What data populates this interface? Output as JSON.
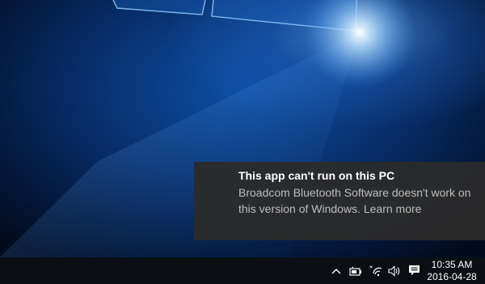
{
  "notification": {
    "title": "This app can't run on this PC",
    "body": "Broadcom Bluetooth Software doesn't work on this version of Windows. Learn more"
  },
  "system_tray": {
    "icons": [
      "chevron-up-icon",
      "battery-charging-icon",
      "wifi-icon",
      "volume-icon",
      "action-center-icon"
    ],
    "time": "10:35 AM",
    "date": "2016-04-28"
  },
  "colors": {
    "toast_background": "#2b2b2b",
    "taskbar": "#0b0f14",
    "wallpaper_blue": "#0d4ea3"
  }
}
